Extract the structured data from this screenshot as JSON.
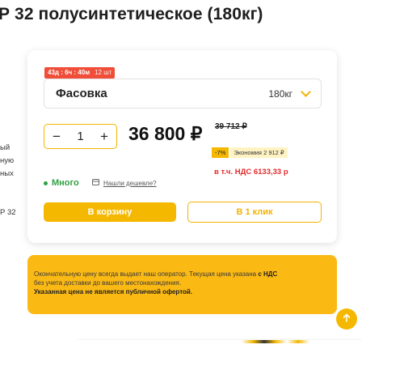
{
  "product": {
    "title": "Р 32 полусинтетическое (180кг)"
  },
  "side_fragments": {
    "line1": "ый",
    "line2": "ную",
    "line3": "ных",
    "line4": "Р 32"
  },
  "timer": {
    "text": "43д : 6ч : 40м",
    "count": "12 шт"
  },
  "packing": {
    "label": "Фасовка",
    "value": "180кг"
  },
  "quantity": {
    "minus": "−",
    "value": "1",
    "plus": "+"
  },
  "price": {
    "current": "36 800 ₽",
    "old": "39 712 ₽",
    "discount_badge": "-7%",
    "economy": "Экономия 2 912 ₽",
    "vat": "в т.ч. НДС 6133,33 р"
  },
  "stock": {
    "status": "Много",
    "cheaper_link": "Нашли дешевле?"
  },
  "buttons": {
    "cart": "В корзину",
    "one_click": "В 1 клик"
  },
  "notice": {
    "part1": "Окончательную цену всегда выдает наш оператор. Текущая цена указана ",
    "bold1": "с НДС",
    "part2": "без учета доставки до вашего местонахождения.",
    "bold2": "Указанная цена не является публичной офертой."
  },
  "icons": {
    "scroll_up": "arrow-up-icon",
    "cheaper": "calculator-icon",
    "dropdown": "chevron-down-icon"
  },
  "colors": {
    "accent": "#f5b800",
    "timer": "#f04e38",
    "stock": "#2ea043",
    "vat": "#e4282a",
    "notice_bg": "#fbb914"
  }
}
